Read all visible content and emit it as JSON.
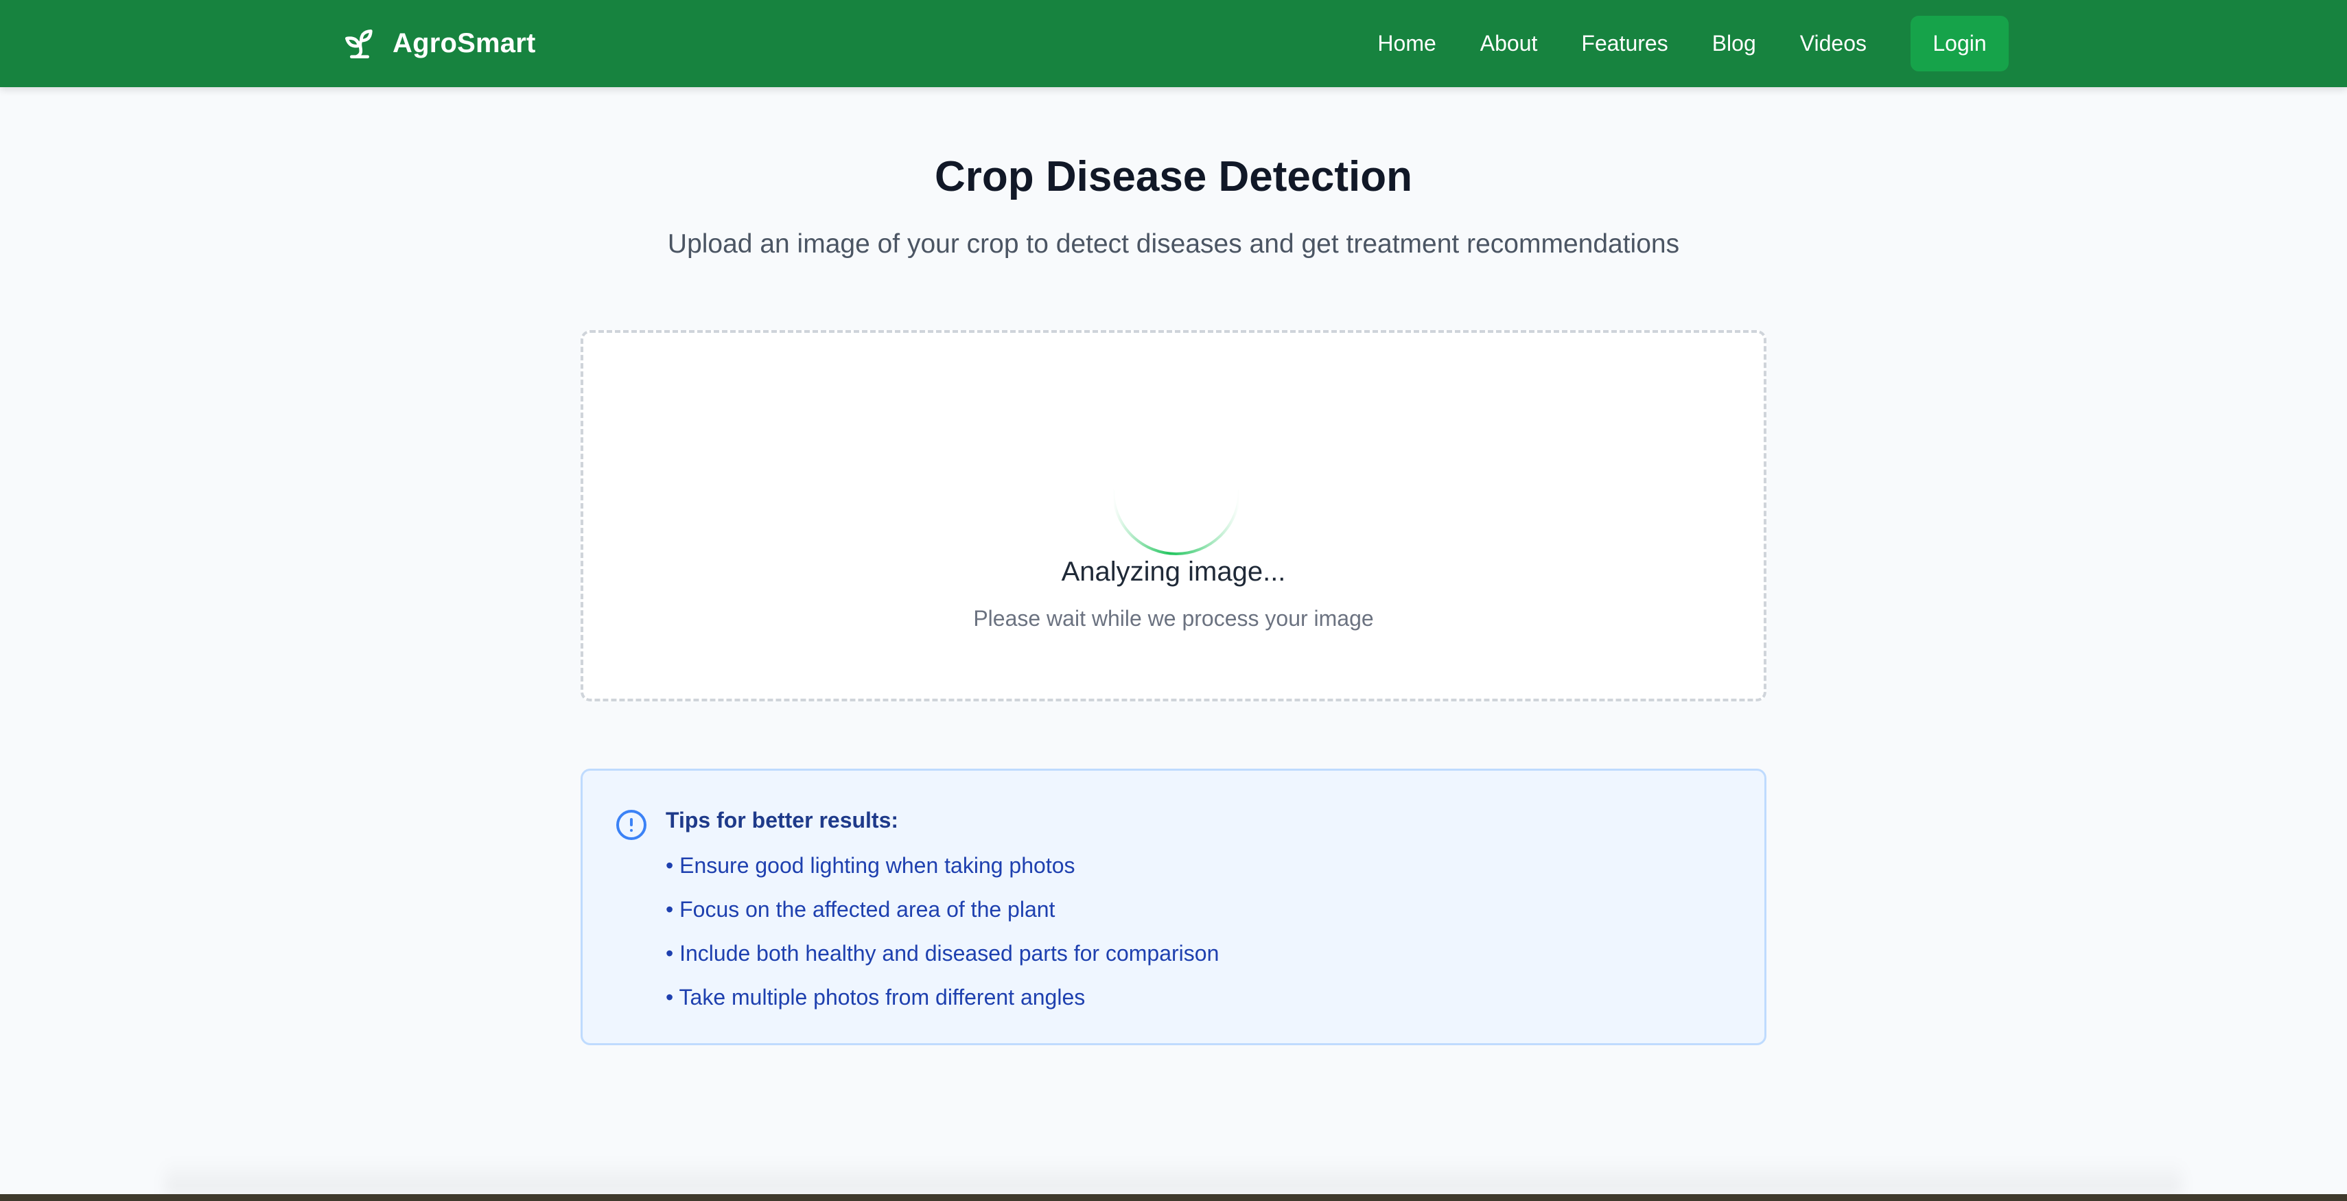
{
  "navbar": {
    "brand": {
      "name": "AgroSmart",
      "icon": "sprout-icon"
    },
    "links": [
      "Home",
      "About",
      "Features",
      "Blog",
      "Videos"
    ],
    "login_label": "Login"
  },
  "main": {
    "title": "Crop Disease Detection",
    "subtitle": "Upload an image of your crop to detect diseases and get treatment recommendations"
  },
  "upload": {
    "status_title": "Analyzing image...",
    "status_message": "Please wait while we process your image"
  },
  "tips": {
    "icon": "info-circle-icon",
    "title": "Tips for better results:",
    "items": [
      "• Ensure good lighting when taking photos",
      "• Focus on the affected area of the plant",
      "• Include both healthy and diseased parts for comparison",
      "• Take multiple photos from different angles"
    ]
  },
  "colors": {
    "nav_bg": "#17833f",
    "login_bg": "#16a34a",
    "spinner": "#22c55e",
    "tips_bg": "#eff6ff",
    "tips_text": "#1e40af"
  }
}
